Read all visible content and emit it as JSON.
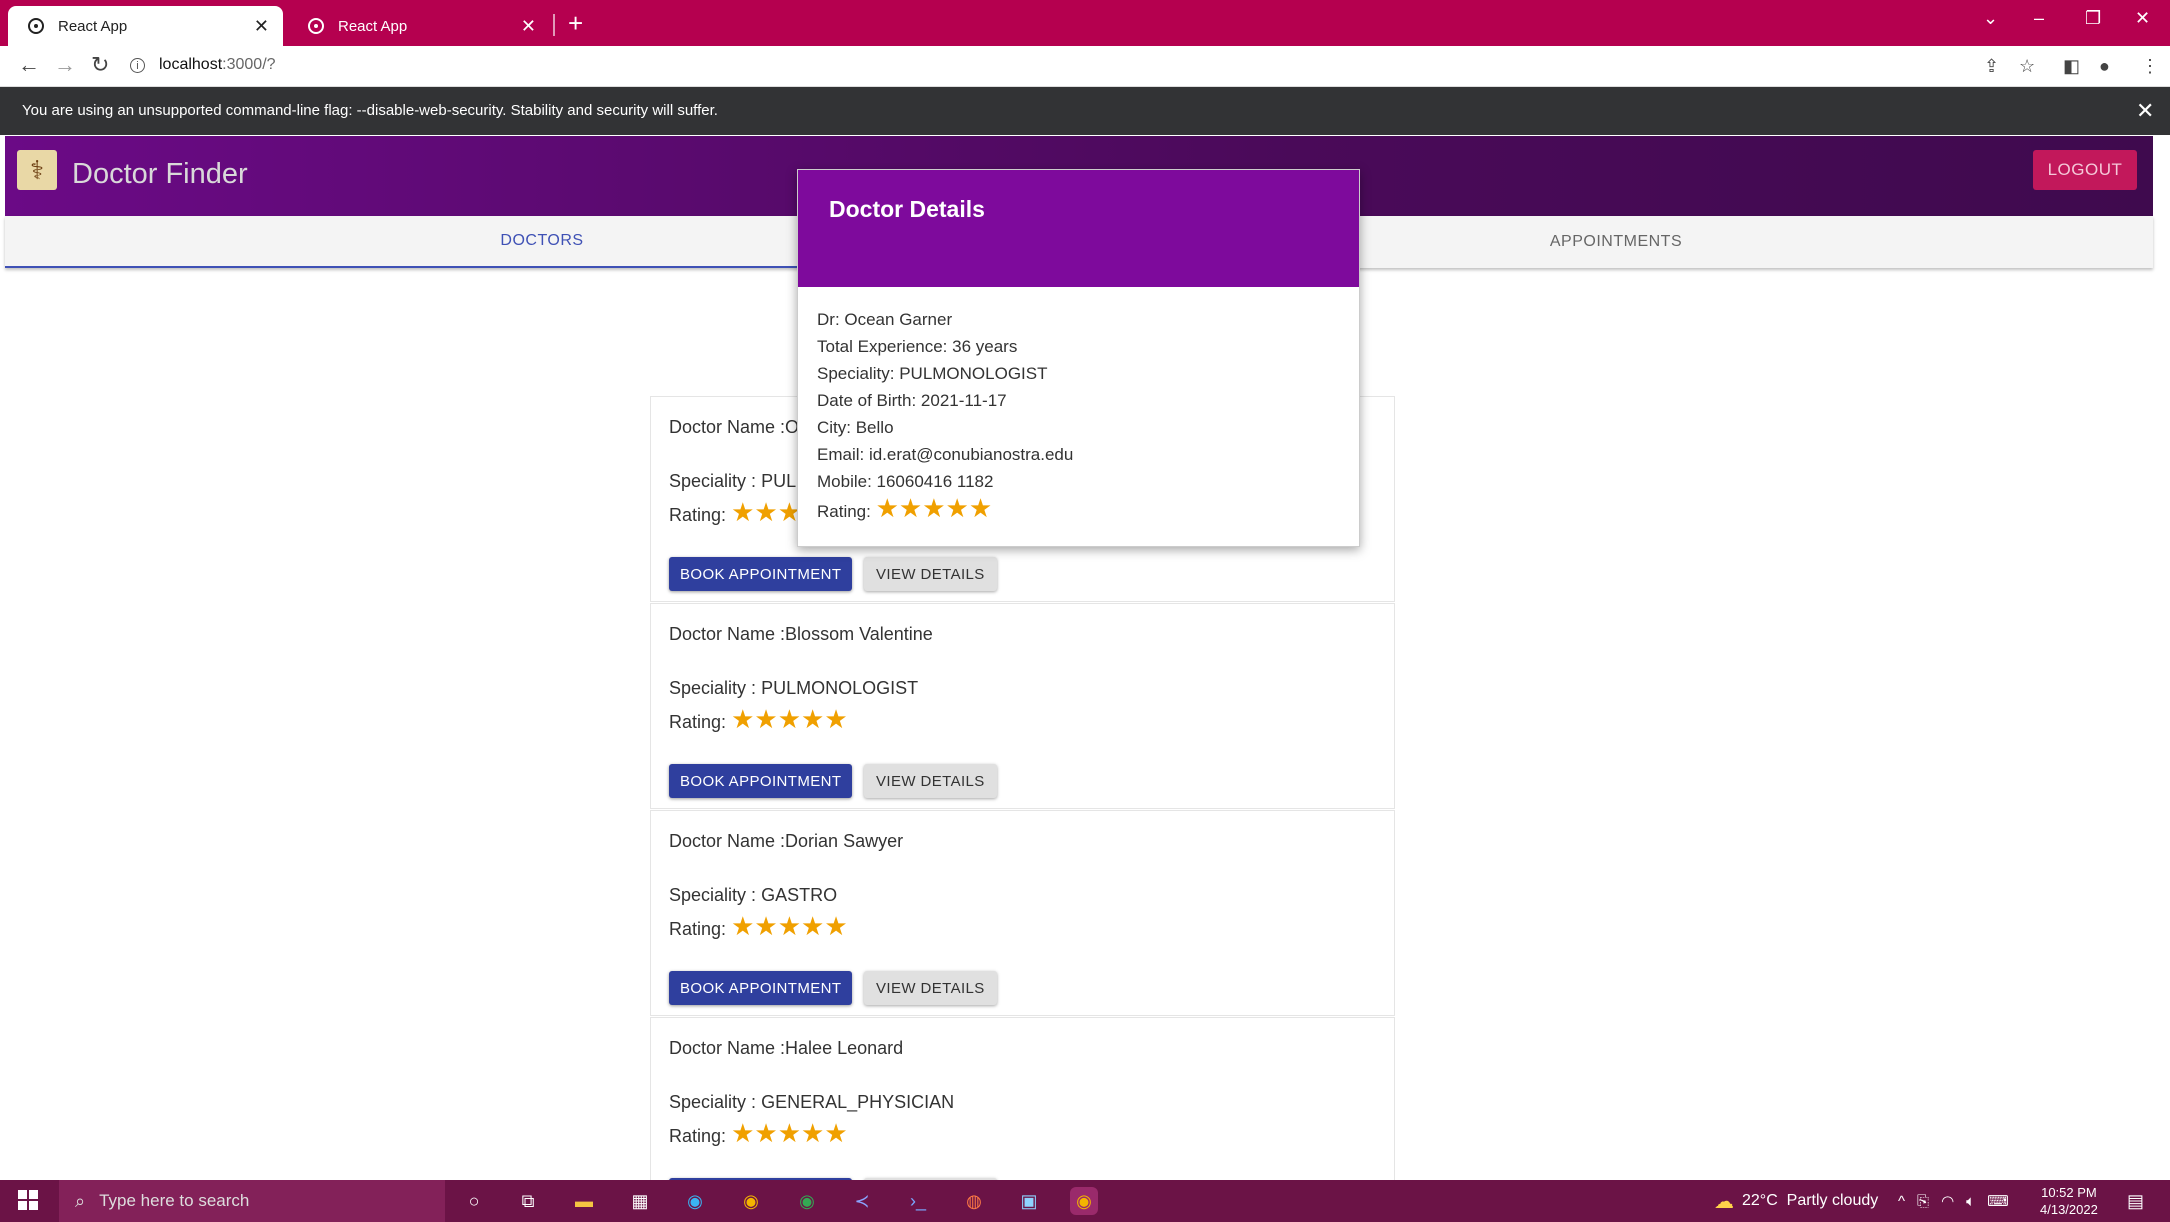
{
  "browser": {
    "tabs": [
      {
        "title": "React App",
        "active": true
      },
      {
        "title": "React App",
        "active": false
      }
    ],
    "url_host": "localhost",
    "url_rest": ":3000/?",
    "infobar_message": "You are using an unsupported command-line flag: --disable-web-security. Stability and security will suffer."
  },
  "app": {
    "title": "Doctor Finder",
    "logout_label": "LOGOUT",
    "tabs": [
      "DOCTORS",
      "APPOINTMENTS"
    ]
  },
  "doctors": [
    {
      "name_prefix": "Doctor Name :",
      "name": "O",
      "speciality_prefix": "Speciality :",
      "speciality": "PUL",
      "rating_label": "Rating:",
      "rating": 5
    },
    {
      "name_prefix": "Doctor Name :",
      "name": "Blossom Valentine",
      "speciality_prefix": "Speciality :",
      "speciality": "PULMONOLOGIST",
      "rating_label": "Rating:",
      "rating": 5
    },
    {
      "name_prefix": "Doctor Name :",
      "name": "Dorian Sawyer",
      "speciality_prefix": "Speciality :",
      "speciality": "GASTRO",
      "rating_label": "Rating:",
      "rating": 5
    },
    {
      "name_prefix": "Doctor Name :",
      "name": "Halee Leonard",
      "speciality_prefix": "Speciality :",
      "speciality": "GENERAL_PHYSICIAN",
      "rating_label": "Rating:",
      "rating": 5
    }
  ],
  "buttons": {
    "book": "BOOK APPOINTMENT",
    "view": "VIEW DETAILS"
  },
  "modal": {
    "title": "Doctor Details",
    "lines": [
      "Dr: Ocean Garner",
      "Total Experience: 36 years",
      "Speciality: PULMONOLOGIST",
      "Date of Birth: 2021-11-17",
      "City: Bello",
      "Email: id.erat@conubianostra.edu",
      "Mobile: 16060416 1182"
    ],
    "rating_label": "Rating:",
    "rating": 5
  },
  "taskbar": {
    "search_placeholder": "Type here to search",
    "weather_temp": "22°C",
    "weather_desc": "Partly cloudy",
    "time": "10:52 PM",
    "date": "4/13/2022"
  },
  "icons": {
    "star": "★",
    "close": "✕"
  },
  "colors": {
    "tabstrip": "#b5004f",
    "header": "#6b0a86",
    "modal_header": "#7e0a9c",
    "primary": "#2f3f9e",
    "star": "#f0a000",
    "logout": "#c2185b"
  }
}
